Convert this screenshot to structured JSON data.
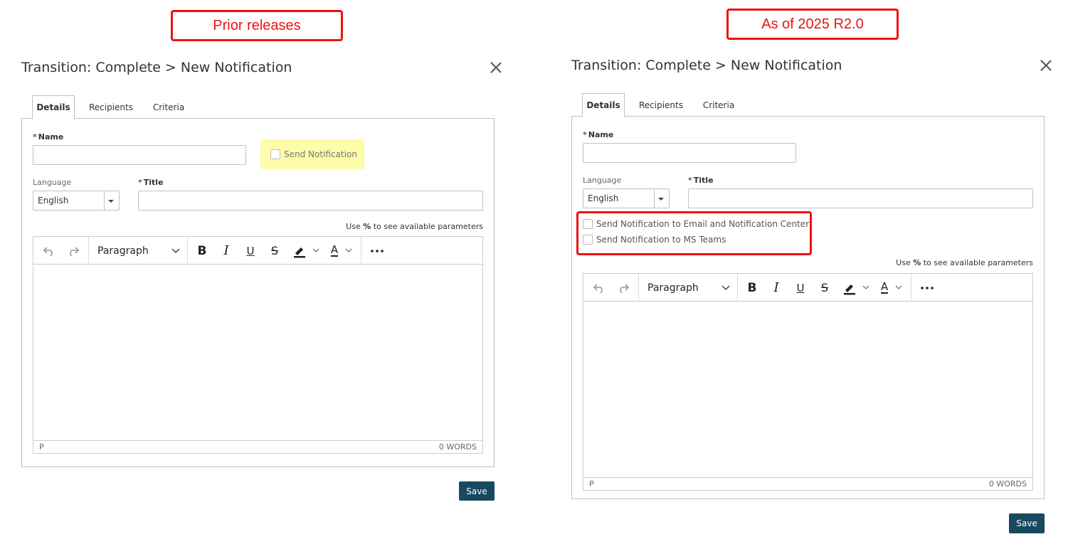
{
  "callouts": {
    "left": "Prior releases",
    "right": "As of 2025 R2.0"
  },
  "left_dialog": {
    "title": "Transition: Complete > New Notification",
    "tabs": [
      "Details",
      "Recipients",
      "Criteria"
    ],
    "name_label": "Name",
    "name_value": "",
    "send_notification_label": "Send Notification",
    "language_label": "Language",
    "language_value": "English",
    "title_label": "Title",
    "title_value": "",
    "hint_prefix": "Use ",
    "hint_key": "%",
    "hint_suffix": " to see available parameters",
    "editor": {
      "format": "Paragraph",
      "status_path": "P",
      "word_count": "0 WORDS"
    },
    "save_label": "Save"
  },
  "right_dialog": {
    "title": "Transition: Complete > New Notification",
    "tabs": [
      "Details",
      "Recipients",
      "Criteria"
    ],
    "name_label": "Name",
    "name_value": "",
    "language_label": "Language",
    "language_value": "English",
    "title_label": "Title",
    "title_value": "",
    "send_email_label": "Send Notification to Email and Notification Center",
    "send_teams_label": "Send Notification to MS Teams",
    "hint_prefix": "Use ",
    "hint_key": "%",
    "hint_suffix": " to see available parameters",
    "editor": {
      "format": "Paragraph",
      "status_path": "P",
      "word_count": "0 WORDS"
    },
    "save_label": "Save"
  },
  "colors": {
    "callout_red": "#ee1111",
    "highlight_yellow": "#fdfdaa",
    "required_star": "#2e7d32",
    "save_button": "#174a5e"
  },
  "icons": [
    "close-icon",
    "undo-icon",
    "redo-icon",
    "chevron-down-icon",
    "bold-icon",
    "italic-icon",
    "underline-icon",
    "strikethrough-icon",
    "highlight-icon",
    "text-color-icon",
    "more-icon"
  ]
}
